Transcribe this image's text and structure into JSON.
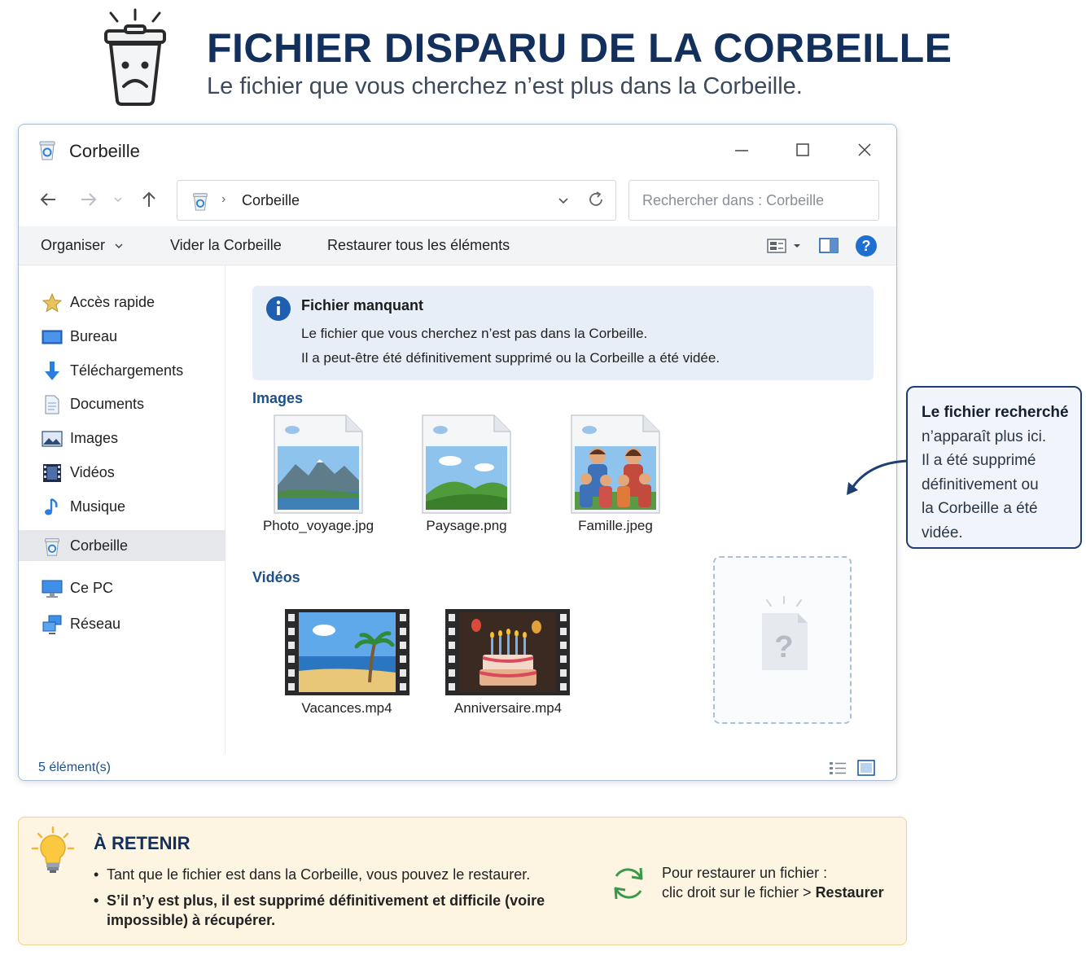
{
  "hero": {
    "title": "FICHIER DISPARU DE LA CORBEILLE",
    "subtitle": "Le fichier que vous cherchez n’est plus dans la Corbeille."
  },
  "window": {
    "title": "Corbeille",
    "address_path": "Corbeille",
    "search_placeholder": "Rechercher dans : Corbeille",
    "commands": {
      "organize": "Organiser",
      "empty": "Vider la Corbeille",
      "restore_all": "Restaurer tous les éléments"
    },
    "sidebar": [
      {
        "label": "Accès rapide",
        "icon": "star-icon"
      },
      {
        "label": "Bureau",
        "icon": "desktop-icon"
      },
      {
        "label": "Téléchargements",
        "icon": "download-icon"
      },
      {
        "label": "Documents",
        "icon": "document-icon"
      },
      {
        "label": "Images",
        "icon": "image-icon"
      },
      {
        "label": "Vidéos",
        "icon": "video-icon"
      },
      {
        "label": "Musique",
        "icon": "music-icon"
      },
      {
        "label": "Corbeille",
        "icon": "recycle-bin-icon",
        "active": true
      },
      {
        "label": "Ce PC",
        "icon": "computer-icon"
      },
      {
        "label": "Réseau",
        "icon": "network-icon"
      }
    ],
    "info": {
      "title": "Fichier manquant",
      "line1": "Le fichier que vous cherchez n’est pas dans la Corbeille.",
      "line2": "Il a peut-être été définitivement supprimé ou la Corbeille a été vidée."
    },
    "sections": {
      "images": "Images",
      "videos": "Vidéos"
    },
    "images": [
      "Photo_voyage.jpg",
      "Paysage.png",
      "Famille.jpeg"
    ],
    "videos": [
      "Vacances.mp4",
      "Anniversaire.mp4"
    ],
    "missing_symbol": "?",
    "status": "5 élément(s)"
  },
  "callout": {
    "lines": [
      "Le fichier recherché",
      "n’apparaît plus ici.",
      "Il a été supprimé",
      "définitivement ou",
      "la Corbeille a été",
      "vidée."
    ]
  },
  "retenir": {
    "title": "À RETENIR",
    "bullet1": "Tant que le fichier est dans la Corbeille, vous pouvez le restaurer.",
    "bullet2a": "S’il n’y est plus, il est supprimé définitivement et difficile (voire",
    "bullet2b": "impossible) à récupérer.",
    "hint1": "Pour restaurer un fichier :",
    "hint2_prefix": "clic droit sur le fichier > ",
    "hint2_action": "Restaurer"
  },
  "colors": {
    "title_navy": "#13305c",
    "accent_blue": "#1d4f8b",
    "info_bg": "#e8eef7",
    "retenir_bg": "#fdf5e1",
    "retenir_border": "#f1d48b"
  }
}
